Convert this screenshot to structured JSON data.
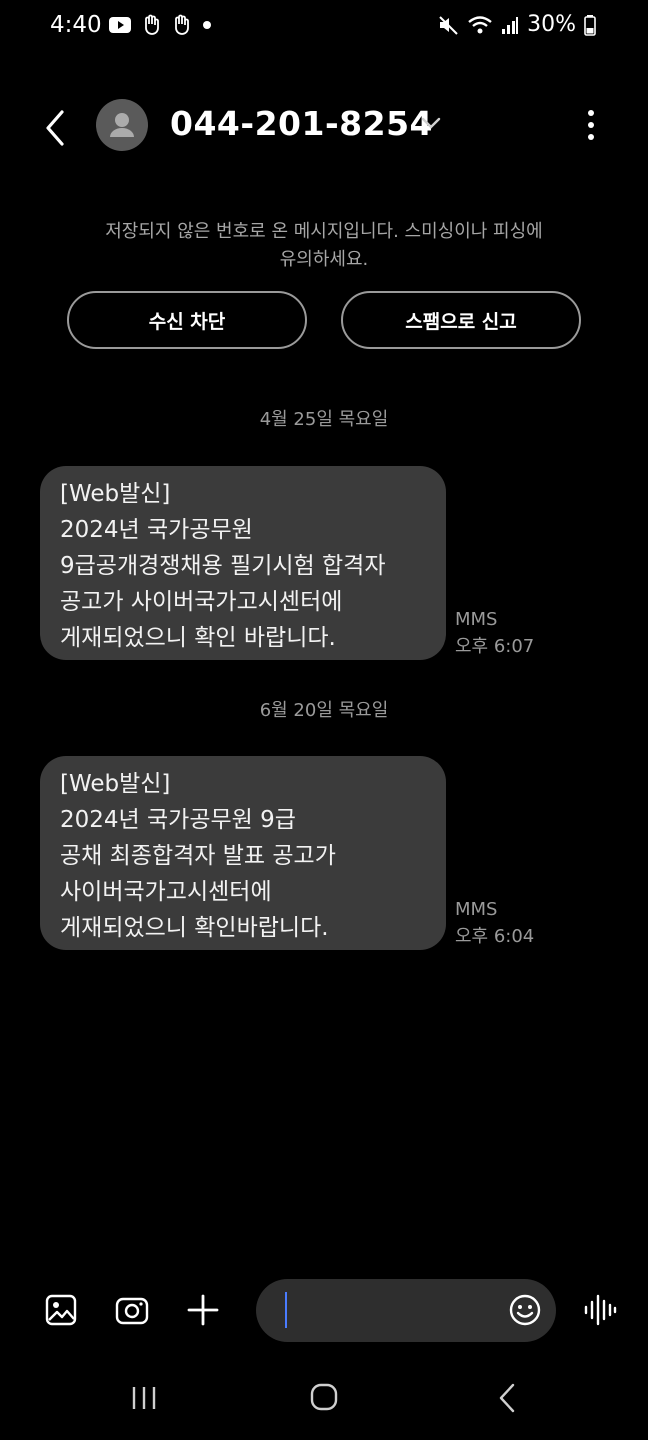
{
  "status_bar": {
    "time": "4:40",
    "battery": "30%",
    "icons": [
      "youtube-icon",
      "hand-icon",
      "hand-icon",
      "dot-icon",
      "mute-icon",
      "wifi-icon",
      "signal-icon",
      "battery-icon"
    ]
  },
  "header": {
    "contact": "044-201-8254",
    "icons": [
      "back-icon",
      "avatar-icon",
      "chevron-down-icon",
      "more-icon"
    ]
  },
  "notice": {
    "line1": "저장되지 않은 번호로 온 메시지입니다. 스미싱이나 피싱에",
    "line2": "유의하세요."
  },
  "actions": {
    "block": "수신 차단",
    "spam": "스팸으로 신고"
  },
  "messages": [
    {
      "date": "4월 25일 목요일",
      "lines": [
        "[Web발신]",
        "2024년 국가공무원",
        "9급공개경쟁채용 필기시험 합격자",
        "공고가 사이버국가고시센터에",
        "게재되었으니 확인 바랍니다."
      ],
      "type": "MMS",
      "time": "오후 6:07"
    },
    {
      "date": "6월 20일 목요일",
      "lines": [
        "[Web발신]",
        "2024년 국가공무원 9급",
        "공채 최종합격자 발표 공고가",
        "사이버국가고시센터에",
        "게재되었으니 확인바랍니다."
      ],
      "type": "MMS",
      "time": "오후 6:04"
    }
  ],
  "composer": {
    "icons": [
      "gallery-icon",
      "camera-icon",
      "plus-icon",
      "emoji-icon",
      "voice-icon"
    ]
  },
  "navbar": {
    "icons": [
      "recent-apps-icon",
      "home-icon",
      "back-nav-icon"
    ]
  },
  "colors": {
    "background": "#000000",
    "bubble": "#3b3b3b",
    "muted_text": "#9a9a9a",
    "cursor": "#4a7cff"
  }
}
